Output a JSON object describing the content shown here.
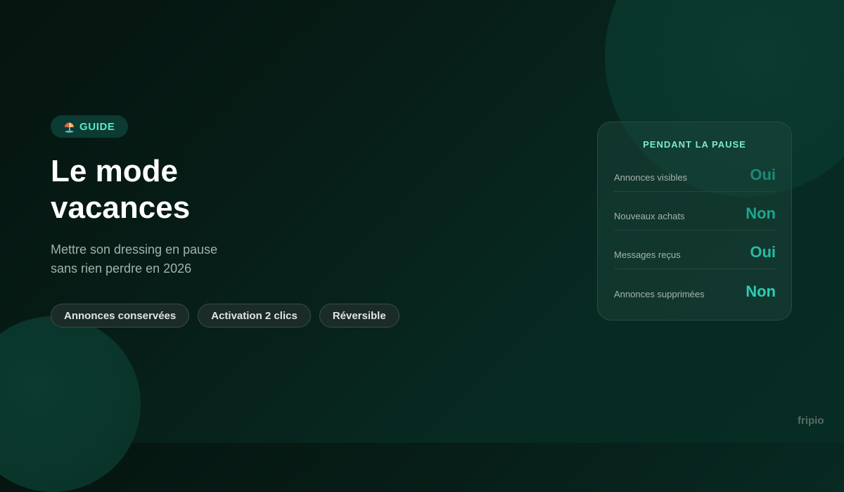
{
  "badge": {
    "icon": "beach-umbrella-icon",
    "label": "GUIDE"
  },
  "title": {
    "line1": "Le mode",
    "line2": "vacances"
  },
  "subtitle": {
    "line1": "Mettre son dressing en pause",
    "line2": "sans rien perdre en 2026"
  },
  "chips": [
    "Annonces conservées",
    "Activation 2 clics",
    "Réversible"
  ],
  "card": {
    "header": "PENDANT LA PAUSE",
    "rows": [
      {
        "label": "Annonces visibles",
        "value": "Oui",
        "color": "#1a8a78"
      },
      {
        "label": "Nouveaux achats",
        "value": "Non",
        "color": "#1fa58f"
      },
      {
        "label": "Messages reçus",
        "value": "Oui",
        "color": "#26bca3"
      },
      {
        "label": "Annonces supprimées",
        "value": "Non",
        "color": "#2ccdb3"
      }
    ]
  },
  "brand": "fripio",
  "colors": {
    "accent": "#5ee6c8",
    "background": "#071d17"
  }
}
